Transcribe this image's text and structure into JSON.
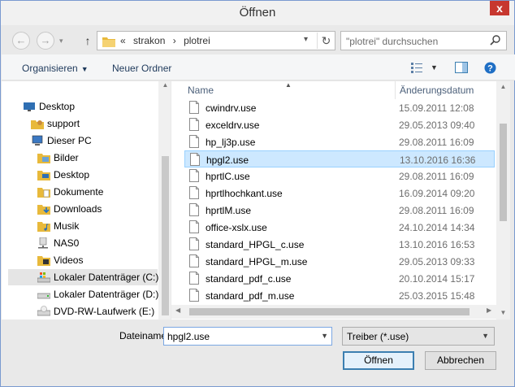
{
  "window": {
    "title": "Öffnen",
    "close_label": "x"
  },
  "nav": {
    "back": "←",
    "forward": "→",
    "up": "↑"
  },
  "address": {
    "overflow": "«",
    "crumbs": [
      "strakon",
      "plotrei"
    ],
    "separator": "›",
    "refresh": "↻"
  },
  "search": {
    "placeholder": "\"plotrei\" durchsuchen"
  },
  "toolbar": {
    "organize": "Organisieren",
    "new_folder": "Neuer Ordner"
  },
  "sidebar": {
    "items": [
      {
        "label": "Desktop",
        "icon": "desktop-icon",
        "level": 0
      },
      {
        "label": "support",
        "icon": "user-folder-icon",
        "level": 1
      },
      {
        "label": "Dieser PC",
        "icon": "computer-icon",
        "level": 1
      },
      {
        "label": "Bilder",
        "icon": "pictures-folder-icon",
        "level": 2
      },
      {
        "label": "Desktop",
        "icon": "desktop-folder-icon",
        "level": 2
      },
      {
        "label": "Dokumente",
        "icon": "documents-folder-icon",
        "level": 2
      },
      {
        "label": "Downloads",
        "icon": "downloads-folder-icon",
        "level": 2
      },
      {
        "label": "Musik",
        "icon": "music-folder-icon",
        "level": 2
      },
      {
        "label": "NAS0",
        "icon": "network-drive-icon",
        "level": 2
      },
      {
        "label": "Videos",
        "icon": "videos-folder-icon",
        "level": 2
      },
      {
        "label": "Lokaler Datenträger (C:)",
        "icon": "system-drive-icon",
        "level": 2,
        "selected": true
      },
      {
        "label": "Lokaler Datenträger (D:)",
        "icon": "drive-icon",
        "level": 2
      },
      {
        "label": "DVD-RW-Laufwerk (E:)",
        "icon": "dvd-drive-icon",
        "level": 2
      }
    ]
  },
  "columns": {
    "name": "Name",
    "date": "Änderungsdatum"
  },
  "files": [
    {
      "name": "cwindrv.use",
      "date": "15.09.2011 12:08"
    },
    {
      "name": "exceldrv.use",
      "date": "29.05.2013 09:40"
    },
    {
      "name": "hp_lj3p.use",
      "date": "29.08.2011 16:09"
    },
    {
      "name": "hpgl2.use",
      "date": "13.10.2016 16:36",
      "selected": true
    },
    {
      "name": "hprtlC.use",
      "date": "29.08.2011 16:09"
    },
    {
      "name": "hprtlhochkant.use",
      "date": "16.09.2014 09:20"
    },
    {
      "name": "hprtlM.use",
      "date": "29.08.2011 16:09"
    },
    {
      "name": "office-xslx.use",
      "date": "24.10.2014 14:34"
    },
    {
      "name": "standard_HPGL_c.use",
      "date": "13.10.2016 16:53"
    },
    {
      "name": "standard_HPGL_m.use",
      "date": "29.05.2013 09:33"
    },
    {
      "name": "standard_pdf_c.use",
      "date": "20.10.2014 15:17"
    },
    {
      "name": "standard_pdf_m.use",
      "date": "25.03.2015 15:48"
    }
  ],
  "footer": {
    "filename_label": "Dateiname:",
    "filename_value": "hpgl2.use",
    "filetype_value": "Treiber (*.use)",
    "open_label": "Öffnen",
    "cancel_label": "Abbrechen"
  },
  "colors": {
    "accent": "#3c7fb1",
    "selection": "#cde8ff",
    "close": "#c7372f",
    "toolbar_text": "#1e395b"
  }
}
